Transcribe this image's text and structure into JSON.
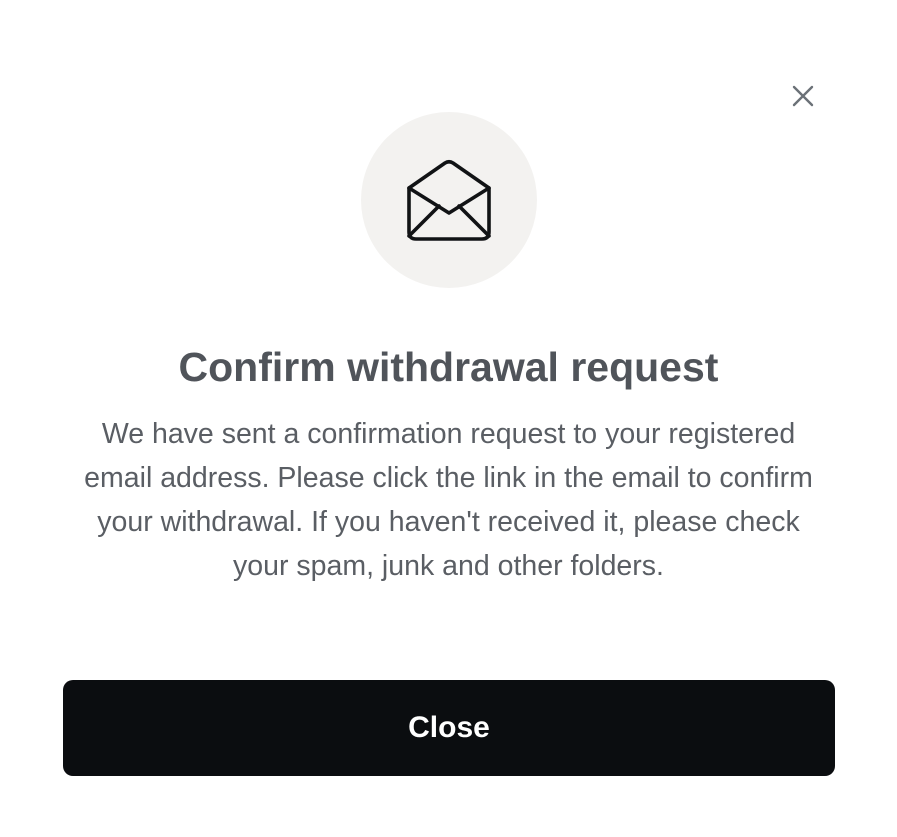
{
  "modal": {
    "title": "Confirm withdrawal request",
    "message": "We have sent a confirmation request to your registered email address. Please click the link in the email to confirm your withdrawal. If you haven't received it, please check your spam, junk and other folders.",
    "close_button_label": "Close",
    "icons": {
      "dismiss": "close-icon",
      "hero": "envelope-open-icon"
    },
    "colors": {
      "icon_circle_bg": "#f3f2f0",
      "title": "#50545a",
      "body_text": "#5a5e64",
      "button_bg": "#0b0d10",
      "button_text": "#ffffff",
      "dismiss_icon": "#6b7177"
    }
  }
}
